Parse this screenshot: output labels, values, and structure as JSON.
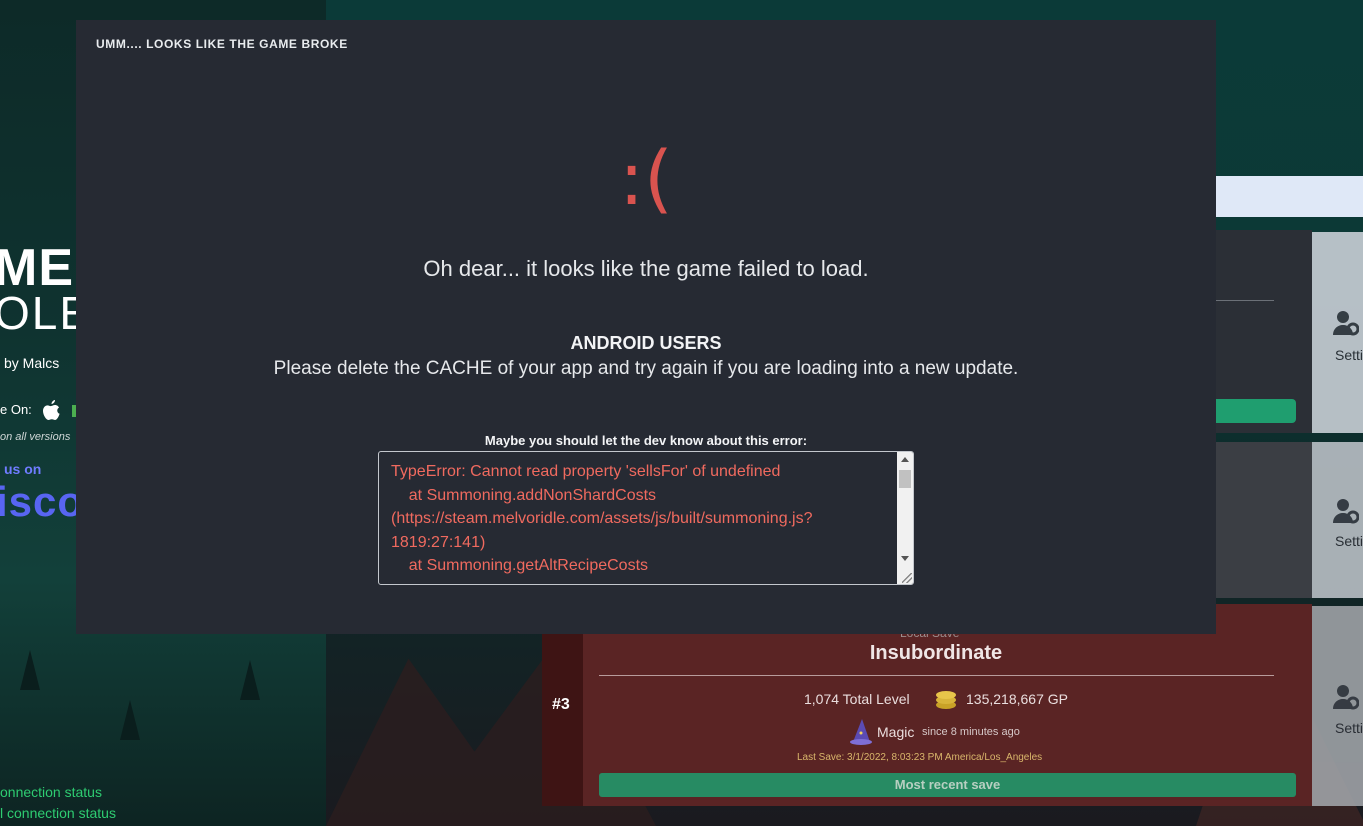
{
  "background": {
    "brand_line1": "MELV",
    "brand_line2": "OLE",
    "by_author": "by Malcs",
    "available_on": "e On:",
    "all_versions": "on all versions",
    "join_us": "us on",
    "discord_word": "isco",
    "connection_status_1": "onnection status",
    "connection_status_2": "l connection status"
  },
  "side_cards": {
    "settings_label": "Settin"
  },
  "save_card": {
    "rank": "#3",
    "top_label": "Local Save",
    "name": "Insubordinate",
    "total_level": "1,074 Total Level",
    "gp": "135,218,667 GP",
    "skill": "Magic",
    "since": "since 8 minutes ago",
    "last_save": "Last Save: 3/1/2022, 8:03:23 PM America/Los_Angeles",
    "button_label": "Most recent save"
  },
  "modal": {
    "title": "UMM.... LOOKS LIKE THE GAME BROKE",
    "sad_face": ":(",
    "failed_message": "Oh dear... it looks like the game failed to load.",
    "android_heading": "ANDROID USERS",
    "android_message": "Please delete the CACHE of your app and try again if you are loading into a new update.",
    "dev_prompt": "Maybe you should let the dev know about this error:",
    "error_text": "TypeError: Cannot read property 'sellsFor' of undefined\n    at Summoning.addNonShardCosts\n(https://steam.melvoridle.com/assets/js/built/summoning.js?\n1819:27:141)\n    at Summoning.getAltRecipeCosts"
  },
  "colors": {
    "modal_bg": "#262a33",
    "sad_face": "#d9534f",
    "error_text": "#f06a5f",
    "success_green": "#1f9e6f",
    "discord_blue": "#5865f2"
  },
  "icons": [
    "apple-icon",
    "person-gear-icon",
    "gold-coins-icon",
    "wizard-hat-icon"
  ]
}
